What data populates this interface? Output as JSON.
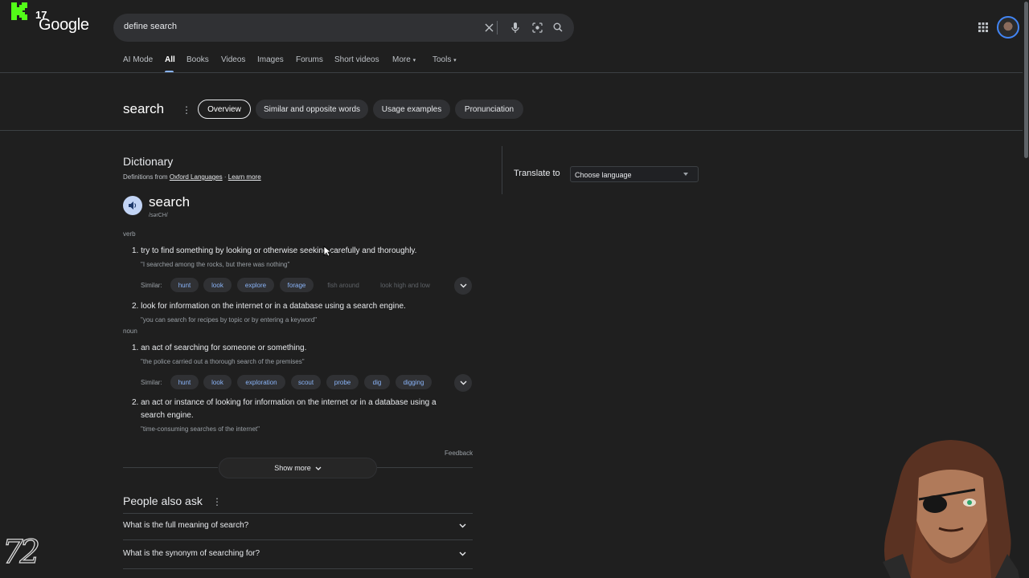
{
  "header": {
    "logo_text": "Google",
    "logo_badge": "17",
    "search_value": "define search"
  },
  "nav_tabs": [
    {
      "label": "AI Mode"
    },
    {
      "label": "All"
    },
    {
      "label": "Books"
    },
    {
      "label": "Videos"
    },
    {
      "label": "Images"
    },
    {
      "label": "Forums"
    },
    {
      "label": "Short videos"
    },
    {
      "label": "More"
    },
    {
      "label": "Tools"
    }
  ],
  "entity": {
    "title": "search",
    "chips": [
      {
        "label": "Overview"
      },
      {
        "label": "Similar and opposite words"
      },
      {
        "label": "Usage examples"
      },
      {
        "label": "Pronunciation"
      }
    ]
  },
  "dictionary": {
    "title": "Dictionary",
    "definitions_from": "Definitions from",
    "source": "Oxford Languages",
    "learn_more": "Learn more",
    "word": "search",
    "phonetic": "/sərCH/",
    "similar_label": "Similar:",
    "verb": {
      "pos": "verb",
      "senses": [
        {
          "number": "1.",
          "definition": "try to find something by looking or otherwise seeking carefully and thoroughly.",
          "example": "\"I searched among the rocks, but there was nothing\"",
          "similar": [
            "hunt",
            "look",
            "explore",
            "forage",
            "fish around",
            "look high and low"
          ]
        },
        {
          "number": "2.",
          "definition": "look for information on the internet or in a database using a search engine.",
          "example": "\"you can search for recipes by topic or by entering a keyword\""
        }
      ]
    },
    "noun": {
      "pos": "noun",
      "senses": [
        {
          "number": "1.",
          "definition": "an act of searching for someone or something.",
          "example": "\"the police carried out a thorough search of the premises\"",
          "similar": [
            "hunt",
            "look",
            "exploration",
            "scout",
            "probe",
            "dig",
            "digging"
          ]
        },
        {
          "number": "2.",
          "definition_line1": "an act or instance of looking for information on the internet or in a database using a",
          "definition_line2": "search engine.",
          "example": "\"time-consuming searches of the internet\""
        }
      ]
    },
    "feedback": "Feedback",
    "show_more": "Show more"
  },
  "translate": {
    "label": "Translate to",
    "placeholder": "Choose language"
  },
  "people_also_ask": {
    "title": "People also ask",
    "questions": [
      "What is the full meaning of search?",
      "What is the synonym of searching for?"
    ]
  },
  "overlays": {
    "watermark": "72"
  },
  "colors": {
    "background": "#1f1f1f",
    "accent_link": "#8ab4f8",
    "chip_bg": "#303134",
    "text": "#e8eaed",
    "muted": "#9aa0a6"
  }
}
